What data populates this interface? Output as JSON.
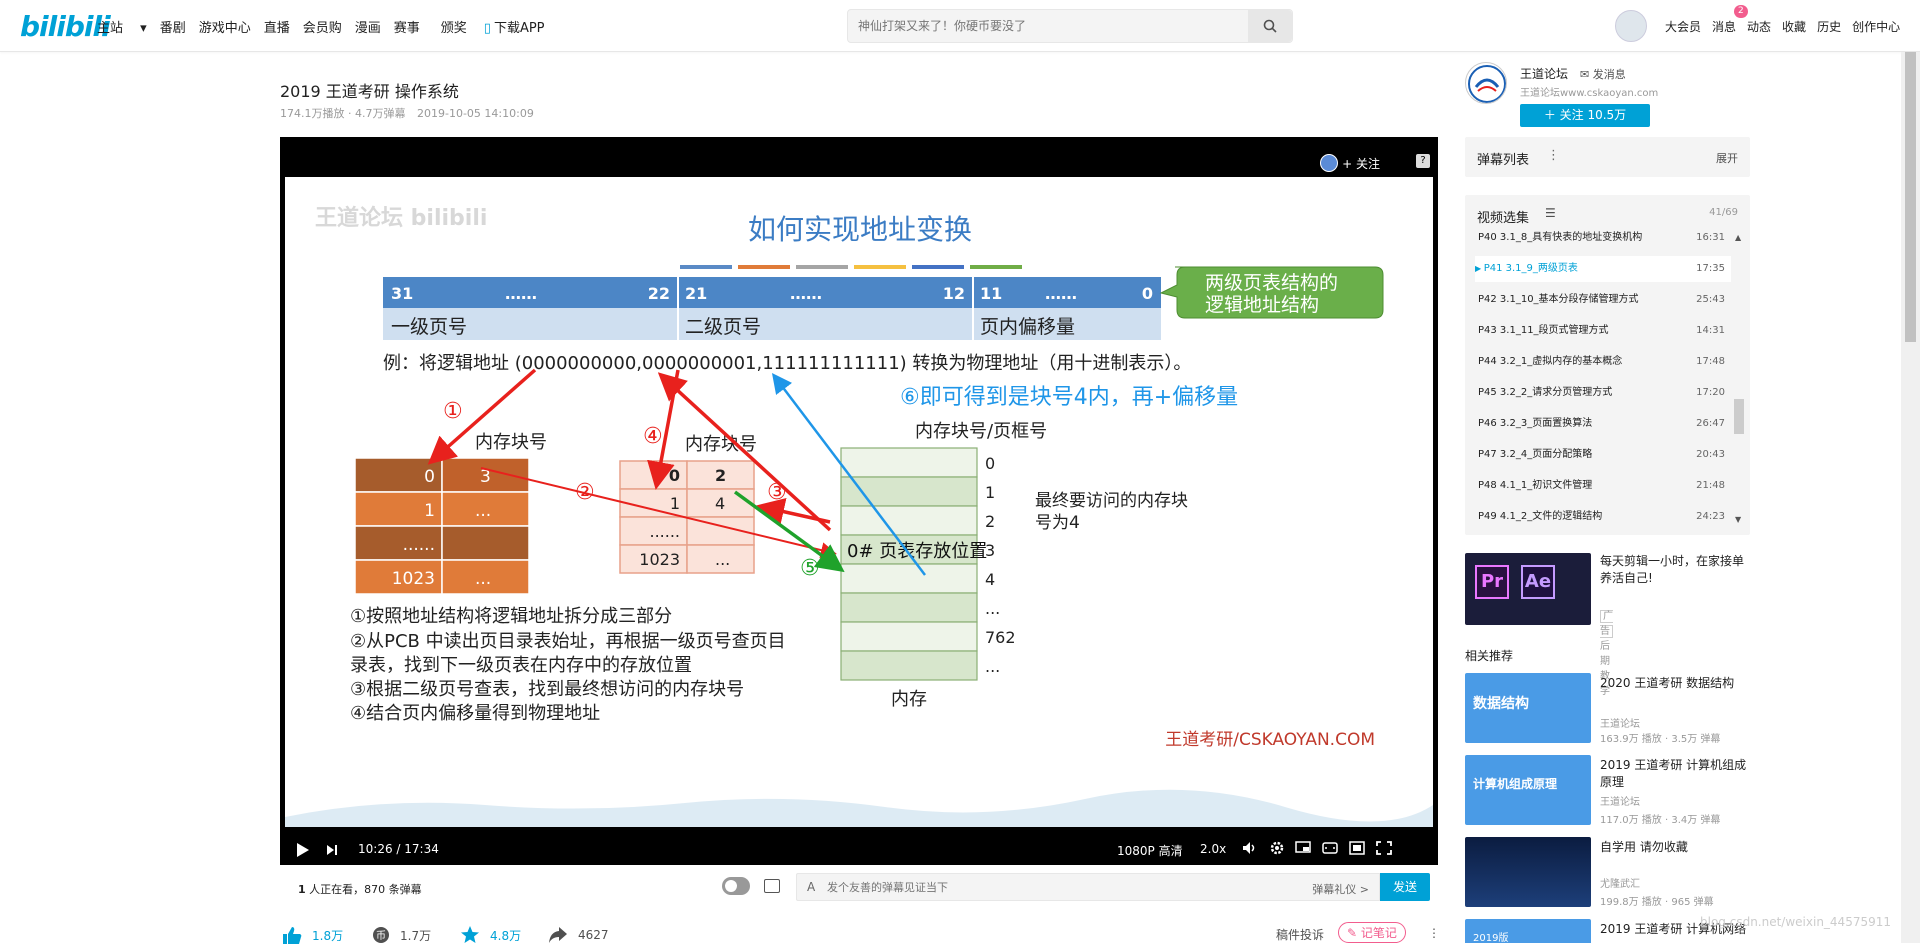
{
  "header": {
    "logo": "bilibili",
    "nav": [
      "主站",
      "番剧",
      "游戏中心",
      "直播",
      "会员购",
      "漫画",
      "赛事",
      "颁奖",
      "下载APP"
    ],
    "search_placeholder": "神仙打架又来了！你硬币要没了",
    "right_nav": [
      "大会员",
      "消息",
      "动态",
      "收藏",
      "历史",
      "创作中心"
    ],
    "message_badge": "2"
  },
  "video": {
    "title": "2019 王道考研 操作系统",
    "plays": "174.1万播放 · 4.7万弹幕",
    "date": "2019-10-05 14:10:09"
  },
  "player": {
    "follow": "+ 关注",
    "time": "10:26 / 17:34",
    "quality": "1080P 高清",
    "speed": "2.0x",
    "progress": 0.594,
    "buffered_end": 0.655
  },
  "slide": {
    "title": "如何实现地址变换",
    "bits": {
      "h1a": "31",
      "h1b": "……",
      "h1c": "22",
      "h2a": "21",
      "h2b": "……",
      "h2c": "12",
      "h3a": "11",
      "h3b": "……",
      "h3c": "0"
    },
    "fields": [
      "一级页号",
      "二级页号",
      "页内偏移量"
    ],
    "callout": "两级页表结构的\n逻辑地址结构",
    "example": "例：将逻辑地址 (0000000000,0000000001,111111111111) 转换为物理地址（用十进制表示）。",
    "note6": "⑥即可得到是块号4内，再+偏移量",
    "mem_title": "内存块号/页框号",
    "mem_label": "内存",
    "left_table_title": "内存块号",
    "left_table": [
      [
        "0",
        "3"
      ],
      [
        "1",
        "..."
      ],
      [
        "......",
        ""
      ],
      [
        "1023",
        "..."
      ]
    ],
    "mid_table_title": "内存块号",
    "mid_table": [
      [
        "0",
        "2"
      ],
      [
        "1",
        "4"
      ],
      [
        "......",
        ""
      ],
      [
        "1023",
        "..."
      ]
    ],
    "mem_rows": [
      "0",
      "1",
      "2",
      "3",
      "4",
      "...",
      "762",
      "..."
    ],
    "mem_pt": "0# 页表存放位置",
    "final_note": "最终要访问的内存块号为4",
    "circled": [
      "①",
      "②",
      "③",
      "④",
      "⑤"
    ],
    "steps": [
      "①按照地址结构将逻辑地址拆分成三部分",
      "②从PCB 中读出页目录表始址，再根据一级页号查页目",
      "录表，找到下一级页表在内存中的存放位置",
      "③根据二级页号查表，找到最终想访问的内存块号",
      "④结合页内偏移量得到物理地址"
    ],
    "watermark": "王道考研/CSKAOYAN.COM"
  },
  "danmaku": {
    "watching_count": "1",
    "watching_suffix": "人正在看，",
    "danmaku_count": "870 条弹幕",
    "input_placeholder": "发个友善的弹幕见证当下",
    "etiquette": "弹幕礼仪 >",
    "send": "发送"
  },
  "actions": {
    "like": "1.8万",
    "coin": "1.7万",
    "fav": "4.8万",
    "share": "4627",
    "report": "稿件投诉",
    "note": "记笔记"
  },
  "uploader": {
    "name": "王道论坛",
    "message": "发消息",
    "desc": "王道论坛www.cskaoyan.com",
    "follow": "关注 10.5万"
  },
  "danmaku_list": {
    "title": "弹幕列表",
    "expand": "展开"
  },
  "episodes": {
    "title": "视频选集",
    "count": "41/69",
    "items": [
      {
        "label": "P40  3.1_8_具有快表的地址变换机构",
        "dur": "16:31"
      },
      {
        "label": "P41  3.1_9_两级页表",
        "dur": "17:35"
      },
      {
        "label": "P42  3.1_10_基本分段存储管理方式",
        "dur": "25:43"
      },
      {
        "label": "P43  3.1_11_段页式管理方式",
        "dur": "14:31"
      },
      {
        "label": "P44  3.2_1_虚拟内存的基本概念",
        "dur": "17:48"
      },
      {
        "label": "P45  3.2_2_请求分页管理方式",
        "dur": "17:20"
      },
      {
        "label": "P46  3.2_3_页面置换算法",
        "dur": "26:47"
      },
      {
        "label": "P47  3.2_4_页面分配策略",
        "dur": "20:43"
      },
      {
        "label": "P48  4.1_1_初识文件管理",
        "dur": "21:48"
      },
      {
        "label": "P49  4.1_2_文件的逻辑结构",
        "dur": "24:23"
      }
    ]
  },
  "ad": {
    "title": "每天剪辑一小时，在家接单养活自己!",
    "tag": "广告",
    "source": "后期教学"
  },
  "related": {
    "title": "相关推荐",
    "items": [
      {
        "title": "2020 王道考研 数据结构",
        "author": "王道论坛",
        "stats": "163.9万 播放 · 3.5万 弹幕",
        "thumb": "数据结构"
      },
      {
        "title": "2019 王道考研 计算机组成原理",
        "author": "王道论坛",
        "stats": "117.0万 播放 · 3.4万 弹幕",
        "thumb": "计算机组成原理"
      },
      {
        "title": "自学用 请勿收藏",
        "author": "尤隆武汇",
        "stats": "199.8万 播放 · 965 弹幕",
        "thumb": ""
      },
      {
        "title": "2019 王道考研 计算机网络",
        "author": "",
        "stats": "",
        "thumb": "2019版"
      }
    ]
  },
  "page_watermark": "blog.csdn.net/weixin_44575911"
}
